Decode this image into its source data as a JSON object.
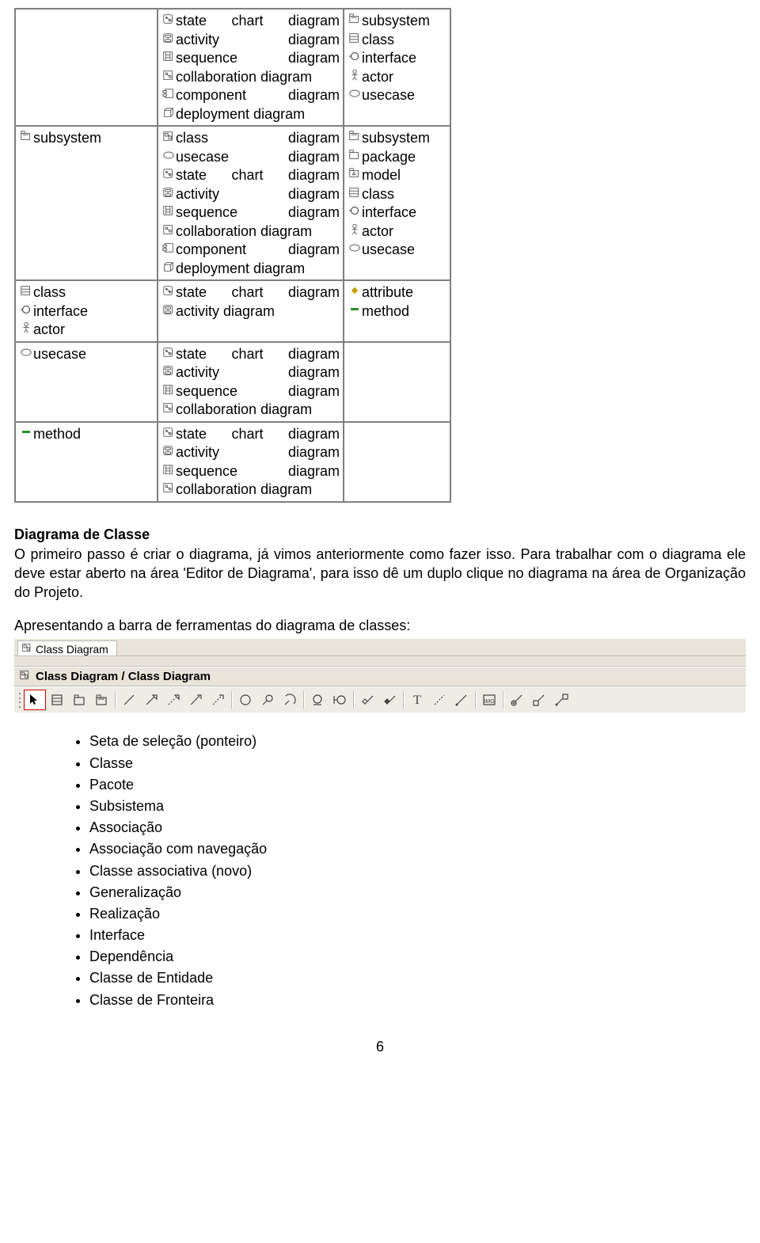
{
  "table": {
    "rows": [
      {
        "col1": [],
        "col2": [
          {
            "icon": "statechart-icon",
            "label": "state chart diagram",
            "justify": true
          },
          {
            "icon": "activity-icon",
            "label": "activity diagram",
            "justify": true
          },
          {
            "icon": "sequence-icon",
            "label": "sequence diagram",
            "justify": true
          },
          {
            "icon": "collaboration-icon",
            "label": "collaboration diagram",
            "justify": false
          },
          {
            "icon": "component-icon",
            "label": "component diagram",
            "justify": true
          },
          {
            "icon": "deployment-icon",
            "label": "deployment diagram",
            "justify": false
          }
        ],
        "col3": [
          {
            "icon": "subsystem-icon",
            "label": "subsystem"
          },
          {
            "icon": "class-icon",
            "label": "class"
          },
          {
            "icon": "interface-icon",
            "label": "interface"
          },
          {
            "icon": "actor-icon",
            "label": "actor"
          },
          {
            "icon": "usecase-icon",
            "label": "usecase"
          }
        ]
      },
      {
        "col1": [
          {
            "icon": "subsystem-icon",
            "label": "subsystem"
          }
        ],
        "col2": [
          {
            "icon": "classdiag-icon",
            "label": "class diagram",
            "justify": true
          },
          {
            "icon": "usecase-icon",
            "label": "usecase diagram",
            "justify": true
          },
          {
            "icon": "statechart-icon",
            "label": "state chart diagram",
            "justify": true
          },
          {
            "icon": "activity-icon",
            "label": "activity diagram",
            "justify": true
          },
          {
            "icon": "sequence-icon",
            "label": "sequence diagram",
            "justify": true
          },
          {
            "icon": "collaboration-icon",
            "label": "collaboration diagram",
            "justify": false
          },
          {
            "icon": "component-icon",
            "label": "component diagram",
            "justify": true
          },
          {
            "icon": "deployment-icon",
            "label": "deployment diagram",
            "justify": false
          }
        ],
        "col3": [
          {
            "icon": "subsystem-icon",
            "label": "subsystem"
          },
          {
            "icon": "package-icon",
            "label": "package"
          },
          {
            "icon": "model-icon",
            "label": "model"
          },
          {
            "icon": "class-icon",
            "label": "class"
          },
          {
            "icon": "interface-icon",
            "label": "interface"
          },
          {
            "icon": "actor-icon",
            "label": "actor"
          },
          {
            "icon": "usecase-icon",
            "label": "usecase"
          }
        ]
      },
      {
        "col1": [
          {
            "icon": "class-icon",
            "label": "class"
          },
          {
            "icon": "interface-icon",
            "label": "interface"
          },
          {
            "icon": "actor-icon",
            "label": "actor"
          }
        ],
        "col2": [
          {
            "icon": "statechart-icon",
            "label": "state chart diagram",
            "justify": true
          },
          {
            "icon": "activity-icon",
            "label": "activity diagram",
            "justify": false
          }
        ],
        "col3": [
          {
            "icon": "attribute-icon",
            "label": "attribute"
          },
          {
            "icon": "method-icon",
            "label": "method"
          }
        ]
      },
      {
        "col1": [
          {
            "icon": "usecase-icon",
            "label": "usecase"
          }
        ],
        "col2": [
          {
            "icon": "statechart-icon",
            "label": "state chart diagram",
            "justify": true
          },
          {
            "icon": "activity-icon",
            "label": "activity diagram",
            "justify": true
          },
          {
            "icon": "sequence-icon",
            "label": "sequence diagram",
            "justify": true
          },
          {
            "icon": "collaboration-icon",
            "label": "collaboration diagram",
            "justify": false
          }
        ],
        "col3": []
      },
      {
        "col1": [
          {
            "icon": "method-icon",
            "label": "method"
          }
        ],
        "col2": [
          {
            "icon": "statechart-icon",
            "label": "state chart diagram",
            "justify": true
          },
          {
            "icon": "activity-icon",
            "label": "activity diagram",
            "justify": true
          },
          {
            "icon": "sequence-icon",
            "label": "sequence diagram",
            "justify": true
          },
          {
            "icon": "collaboration-icon",
            "label": "collaboration diagram",
            "justify": false
          }
        ],
        "col3": []
      }
    ]
  },
  "heading": "Diagrama de Classe",
  "paragraph": "O primeiro passo é criar o diagrama, já vimos anteriormente como fazer isso. Para trabalhar com o diagrama ele deve estar aberto na área 'Editor de Diagrama', para isso dê um duplo clique no diagrama na área de Organização do Projeto.",
  "subtext": "Apresentando a barra de ferramentas do diagrama de classes:",
  "tab_label": "Class Diagram",
  "title_label": "Class Diagram / Class Diagram",
  "toolbar": [
    {
      "name": "pointer-tool",
      "icon": "arrow",
      "selected": true
    },
    {
      "name": "class-tool",
      "icon": "classbox"
    },
    {
      "name": "package-tool",
      "icon": "pkg"
    },
    {
      "name": "subsystem-tool",
      "icon": "subsys"
    },
    {
      "name": "sep"
    },
    {
      "name": "association-tool",
      "icon": "line"
    },
    {
      "name": "generalization-tool",
      "icon": "gen"
    },
    {
      "name": "realization-tool",
      "icon": "real"
    },
    {
      "name": "nav-association-tool",
      "icon": "navassoc"
    },
    {
      "name": "dependency-tool",
      "icon": "dep"
    },
    {
      "name": "sep"
    },
    {
      "name": "interface-tool",
      "icon": "iface"
    },
    {
      "name": "lollipop-tool",
      "icon": "lolli"
    },
    {
      "name": "required-interface-tool",
      "icon": "reqif"
    },
    {
      "name": "sep"
    },
    {
      "name": "entity-class-tool",
      "icon": "entity"
    },
    {
      "name": "boundary-class-tool",
      "icon": "boundary"
    },
    {
      "name": "sep"
    },
    {
      "name": "aggregation-tool",
      "icon": "aggr"
    },
    {
      "name": "composition-tool",
      "icon": "comp"
    },
    {
      "name": "sep"
    },
    {
      "name": "text-tool",
      "icon": "text"
    },
    {
      "name": "anchor-tool",
      "icon": "anchordash"
    },
    {
      "name": "anchor-line-tool",
      "icon": "anchorline"
    },
    {
      "name": "sep"
    },
    {
      "name": "image-tool",
      "icon": "img"
    },
    {
      "name": "sep"
    },
    {
      "name": "nesting-tool",
      "icon": "nest"
    },
    {
      "name": "containment-tool",
      "icon": "cont"
    },
    {
      "name": "anchor-class-tool",
      "icon": "anchorclass"
    }
  ],
  "bullets": [
    "Seta de seleção (ponteiro)",
    "Classe",
    "Pacote",
    "Subsistema",
    "Associação",
    "Associação com navegação",
    "Classe associativa (novo)",
    "Generalização",
    "Realização",
    "Interface",
    "Dependência",
    "Classe de Entidade",
    "Classe de Fronteira"
  ],
  "page_number": "6"
}
